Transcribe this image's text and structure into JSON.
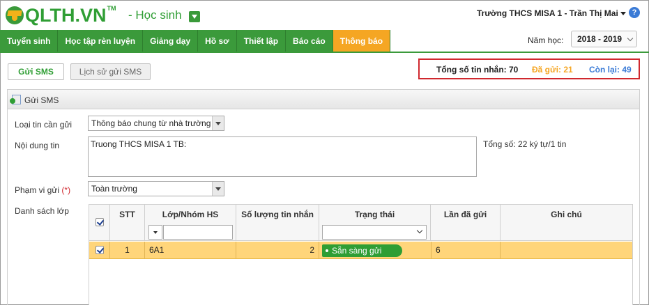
{
  "header": {
    "logo_text": "QLTH.VN",
    "logo_tm": "TM",
    "role": "- Học sinh",
    "user": "Trường THCS MISA 1 - Trần Thị Mai"
  },
  "nav": {
    "items": [
      "Tuyển sinh",
      "Học tập rèn luyện",
      "Giảng dạy",
      "Hồ sơ",
      "Thiết lập",
      "Báo cáo",
      "Thông báo"
    ],
    "active": "Thông báo",
    "year_label": "Năm học:",
    "year_value": "2018 - 2019"
  },
  "tabs": {
    "send": "Gửi SMS",
    "history": "Lịch sử gửi SMS"
  },
  "summary": {
    "total": "Tổng số tin nhắn: 70",
    "sent": "Đã gửi: 21",
    "remaining": "Còn lại: 49"
  },
  "panel": {
    "title": "Gửi SMS"
  },
  "form": {
    "type_label": "Loại tin cần gửi",
    "type_value": "Thông báo chung từ nhà trường",
    "content_label": "Nội dung tin",
    "content_value": "Truong THCS MISA 1 TB:",
    "counter": "Tổng số: 22 ký tự/1 tin",
    "scope_label": "Phạm vi gửi",
    "scope_required": "(*)",
    "scope_value": "Toàn trường",
    "list_label": "Danh sách lớp"
  },
  "grid": {
    "columns": {
      "stt": "STT",
      "class": "Lớp/Nhóm HS",
      "count": "Số lượng tin nhắn",
      "status": "Trạng thái",
      "times": "Lần đã gửi",
      "note": "Ghi chú"
    },
    "rows": [
      {
        "stt": "1",
        "class": "6A1",
        "count": "2",
        "status": "Sẵn sàng gửi",
        "times": "6",
        "note": ""
      }
    ]
  },
  "colors": {
    "brand_green": "#2f9e34",
    "active_tab": "#f5a623",
    "sent": "#f5a623",
    "remaining": "#3b7bd6",
    "summary_border": "#d0282e",
    "selected_row": "#ffd57a"
  },
  "icons": {
    "logo": "graduation-cap-icon",
    "role_dropdown": "dropdown-arrow-icon",
    "help": "help-icon",
    "panel": "sms-icon"
  }
}
